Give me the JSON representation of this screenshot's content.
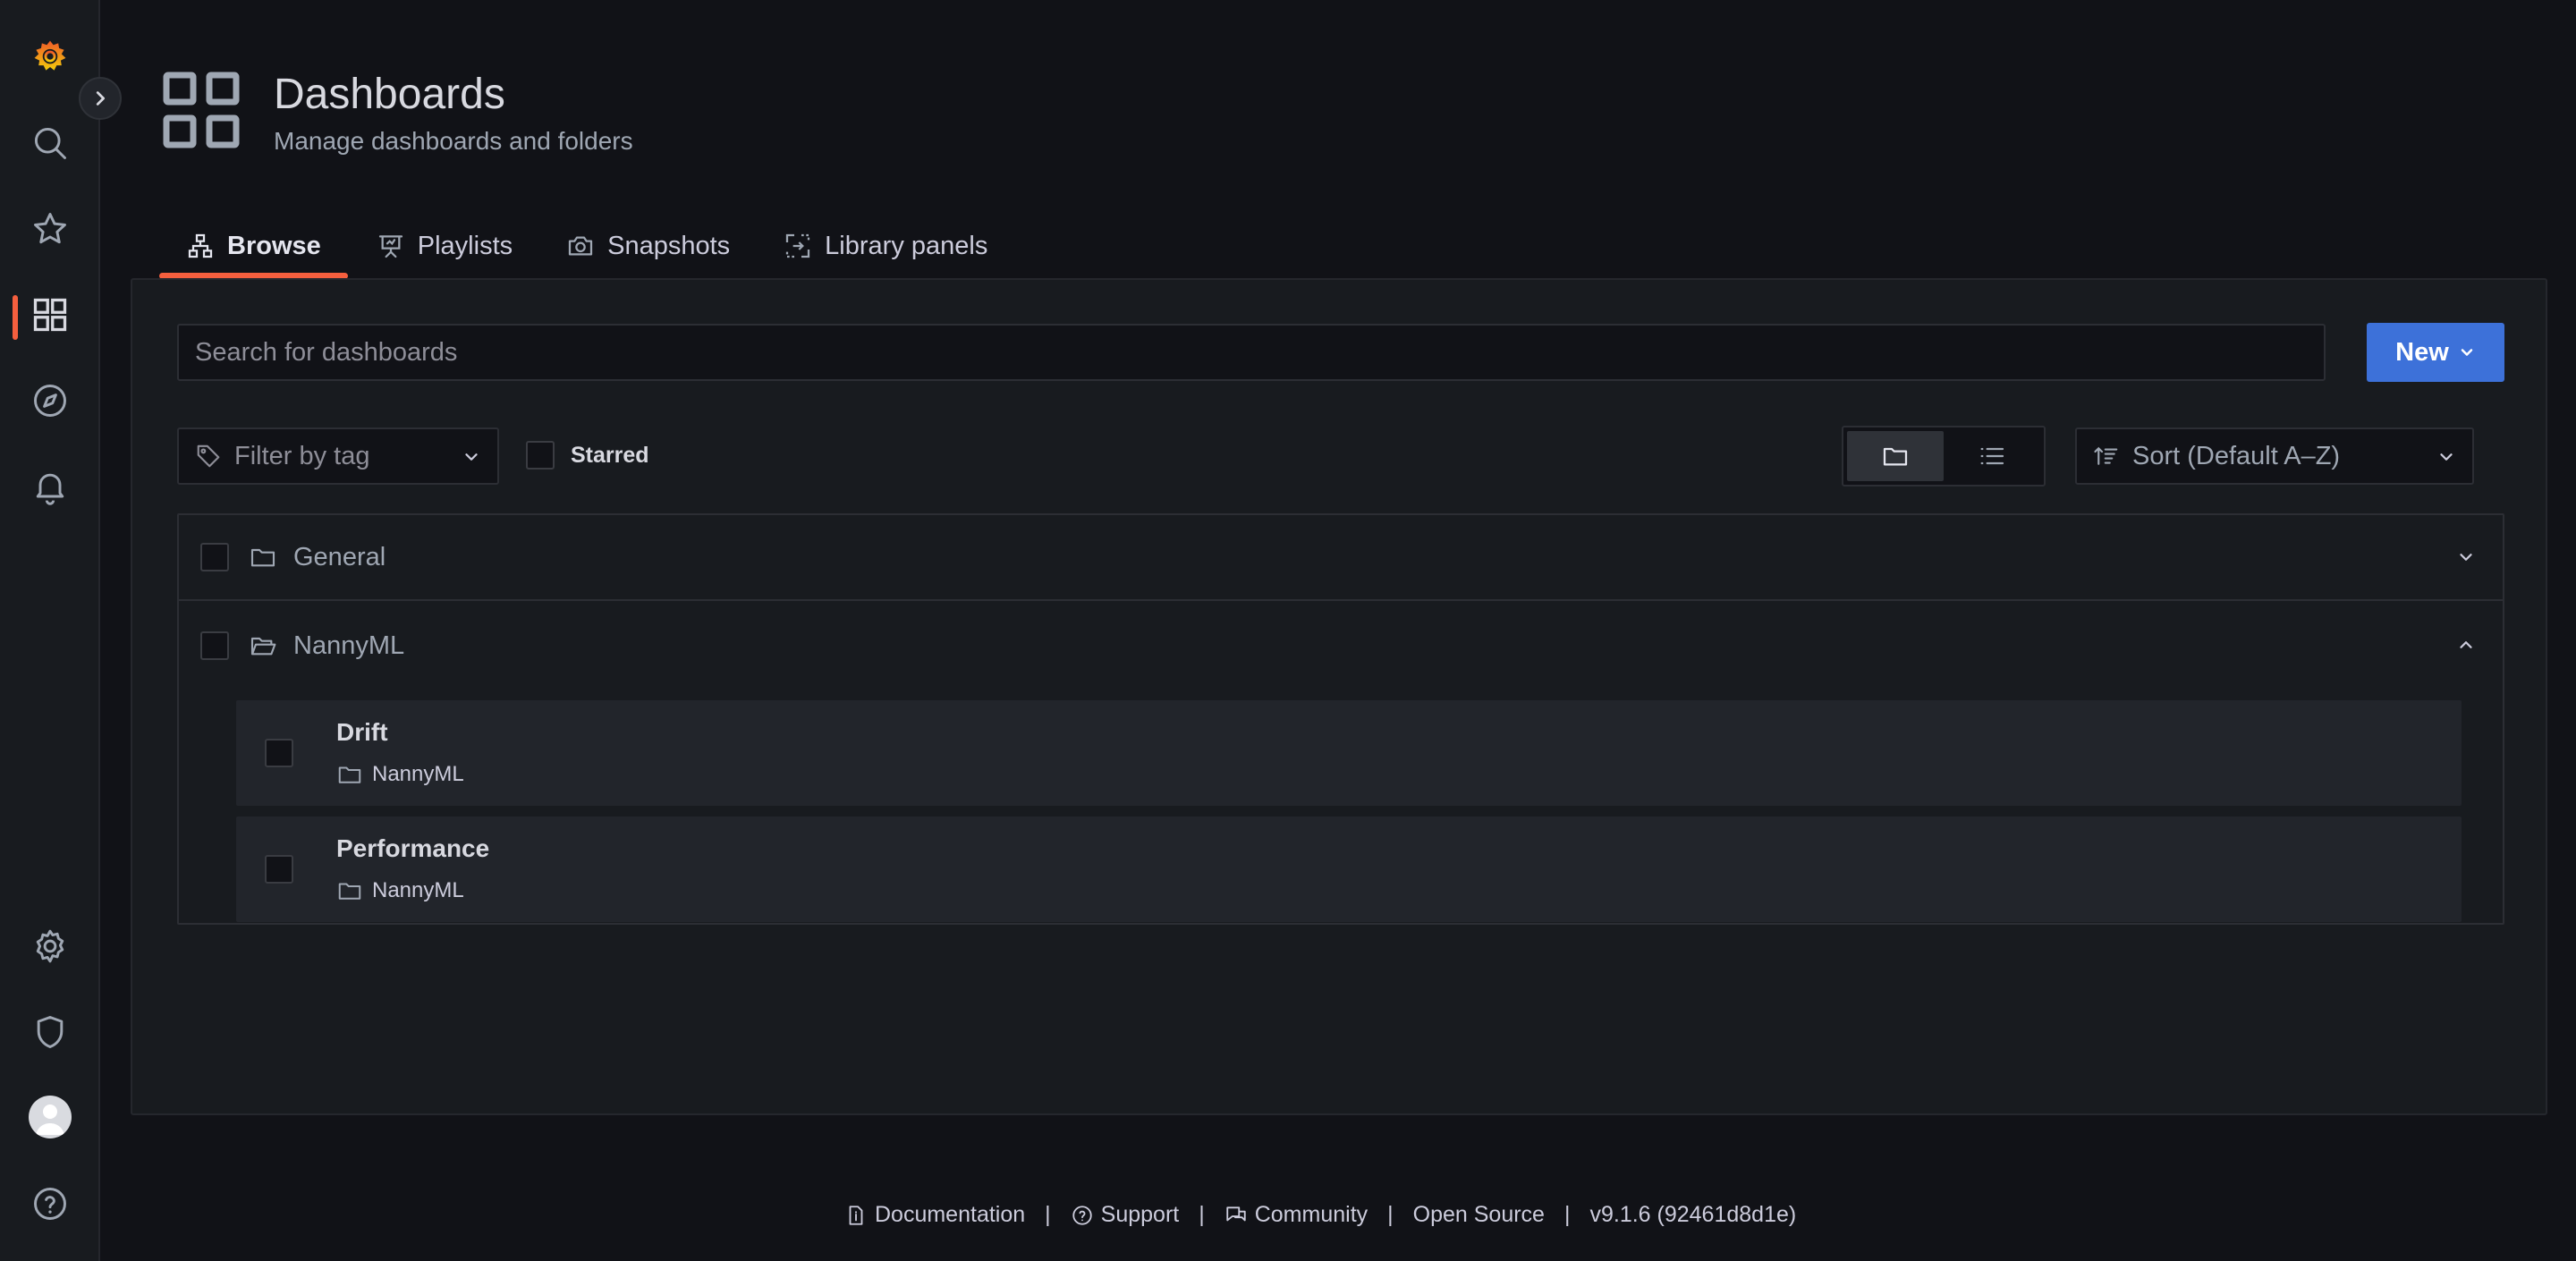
{
  "header": {
    "title": "Dashboards",
    "subtitle": "Manage dashboards and folders"
  },
  "sidebar": {
    "items": [
      {
        "name": "grafana-logo",
        "icon": "grafana-logo"
      },
      {
        "name": "search",
        "icon": "search-icon"
      },
      {
        "name": "starred",
        "icon": "star-icon"
      },
      {
        "name": "dashboards",
        "icon": "dashboards-icon",
        "active": true
      },
      {
        "name": "explore",
        "icon": "compass-icon"
      },
      {
        "name": "alerting",
        "icon": "bell-icon"
      },
      {
        "name": "configuration",
        "icon": "gear-icon"
      },
      {
        "name": "server-admin",
        "icon": "shield-icon"
      },
      {
        "name": "profile",
        "icon": "avatar"
      },
      {
        "name": "help",
        "icon": "help-icon"
      }
    ]
  },
  "tabs": [
    {
      "label": "Browse",
      "icon": "sitemap-icon",
      "active": true
    },
    {
      "label": "Playlists",
      "icon": "presentation-icon"
    },
    {
      "label": "Snapshots",
      "icon": "camera-icon"
    },
    {
      "label": "Library panels",
      "icon": "library-panels-icon"
    }
  ],
  "search": {
    "placeholder": "Search for dashboards",
    "value": ""
  },
  "new_button": {
    "label": "New"
  },
  "filters": {
    "tag_placeholder": "Filter by tag",
    "starred_label": "Starred",
    "sort_label": "Sort (Default A–Z)",
    "view_mode": "folders"
  },
  "folders": [
    {
      "name": "General",
      "expanded": false
    },
    {
      "name": "NannyML",
      "expanded": true,
      "dashboards": [
        {
          "title": "Drift",
          "folder": "NannyML"
        },
        {
          "title": "Performance",
          "folder": "NannyML"
        }
      ]
    }
  ],
  "footer": {
    "links": [
      "Documentation",
      "Support",
      "Community",
      "Open Source"
    ],
    "version": "v9.1.6 (92461d8d1e)"
  },
  "colors": {
    "accent": "#f55f3e",
    "primary_button": "#3d71d9",
    "background": "#111217",
    "panel": "#181b1f"
  }
}
